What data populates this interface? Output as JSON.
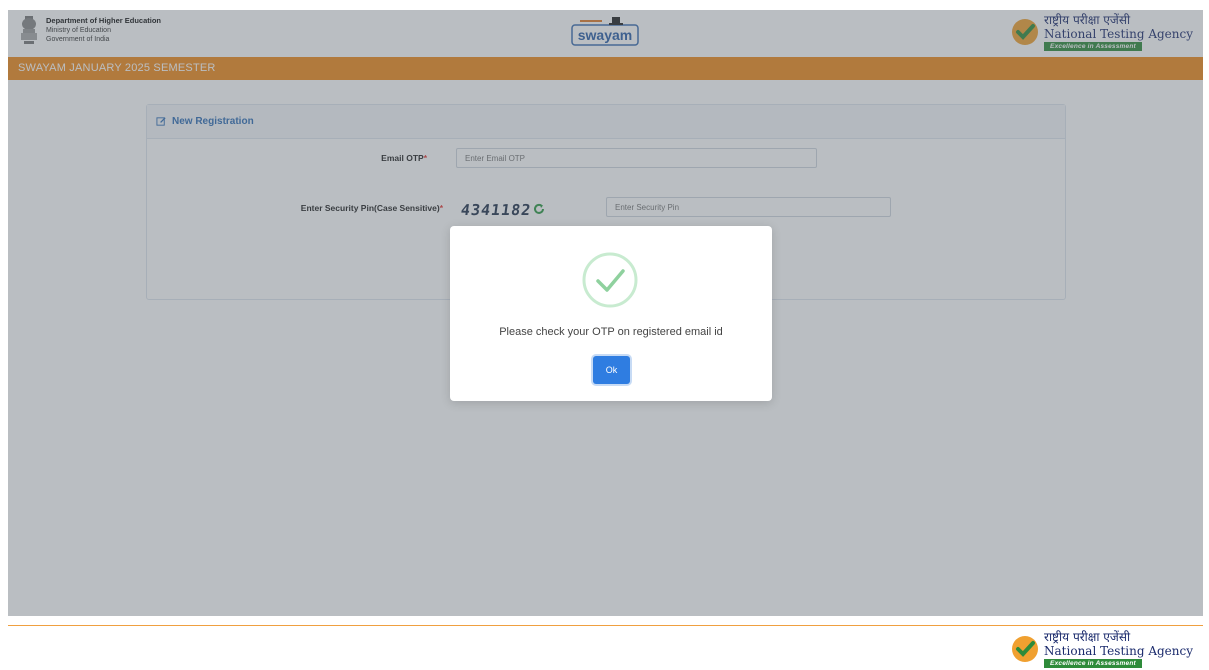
{
  "header": {
    "dept_line1": "Department of Higher Education",
    "dept_line2": "Ministry of Education",
    "dept_line3": "Government of India",
    "swayam_logo_text": "swayam",
    "nta_hindi": "राष्ट्रीय परीक्षा एजेंसी",
    "nta_english": "National Testing Agency",
    "nta_tagline": "Excellence in Assessment"
  },
  "band": {
    "title": "SWAYAM JANUARY 2025 SEMESTER"
  },
  "form": {
    "panel_title": "New Registration",
    "email_otp_label": "Email OTP",
    "email_otp_placeholder": "Enter Email OTP",
    "security_pin_label": "Enter Security Pin(Case Sensitive)",
    "captcha_text": "4341182",
    "security_pin_placeholder": "Enter Security Pin",
    "required_mark": "*"
  },
  "modal": {
    "message": "Please check your OTP on registered email id",
    "ok_label": "Ok"
  },
  "footer": {
    "nta_hindi": "राष्ट्रीय परीक्षा एजेंसी",
    "nta_english": "National Testing Agency",
    "nta_tagline": "Excellence in Assessment"
  },
  "colors": {
    "band": "#f08a1a",
    "link_blue": "#2f6db5",
    "ok_button": "#2f7de1",
    "success_green": "#8fd19e",
    "required_red": "#e53935"
  }
}
